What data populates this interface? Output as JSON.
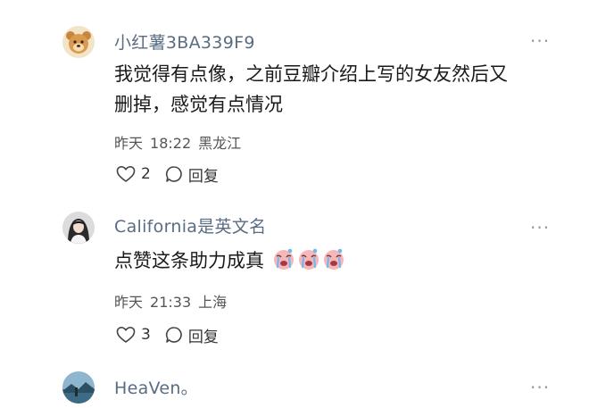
{
  "comments": [
    {
      "username": "小红薯3BA339F9",
      "content_line1": "我觉得有点像，之前豆瓣介绍上写的女友然后又",
      "content_line2": "删掉，感觉有点情况",
      "date": "昨天",
      "time": "18:22",
      "location": "黑龙江",
      "likes": "2",
      "reply_label": "回复",
      "more": "···",
      "avatar_icon": "bear-avatar-icon"
    },
    {
      "username": "California是英文名",
      "content": "点赞这条助力成真",
      "emojis": [
        "crying-face-icon",
        "crying-face-icon",
        "crying-face-icon"
      ],
      "date": "昨天",
      "time": "21:33",
      "location": "上海",
      "likes": "3",
      "reply_label": "回复",
      "more": "···",
      "avatar_icon": "girl-avatar-icon"
    },
    {
      "username": "HeaVen。",
      "more": "···",
      "avatar_icon": "landscape-avatar-icon"
    }
  ],
  "colors": {
    "username": "#5a6c82",
    "text": "#1a1a1a",
    "meta": "#555555",
    "icon": "#9a9a9a"
  }
}
